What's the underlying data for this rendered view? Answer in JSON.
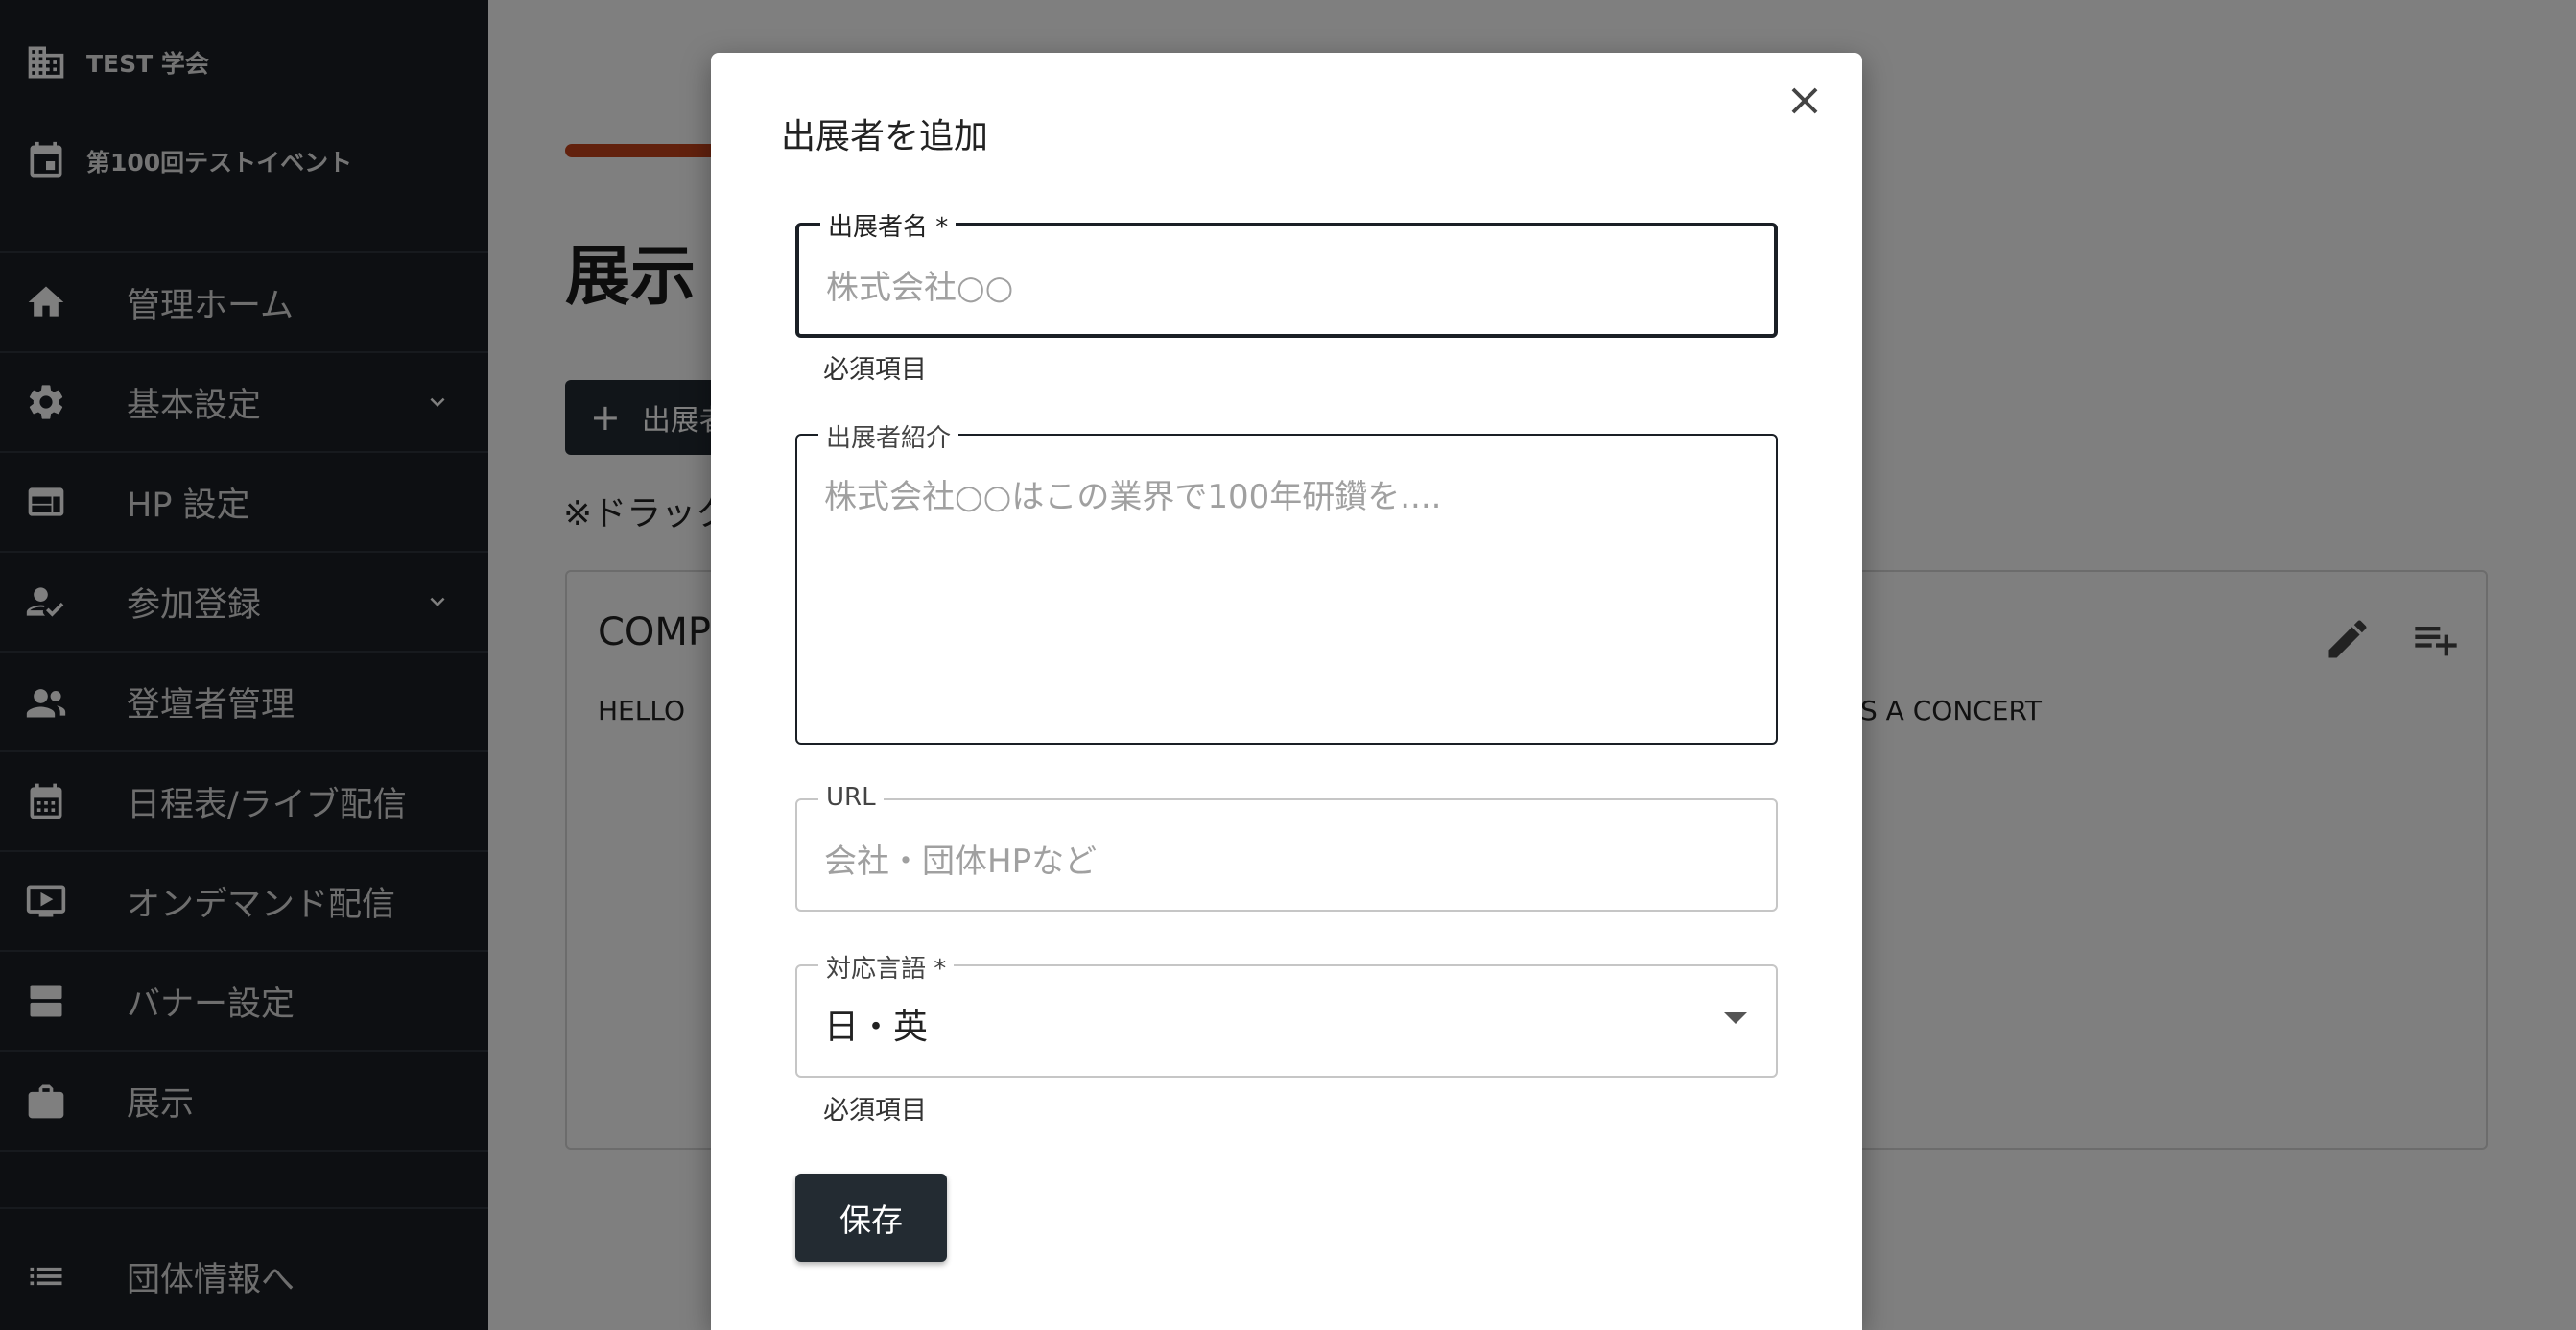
{
  "sidebar": {
    "org": [
      {
        "label": "TEST 学会",
        "icon": "building-icon"
      },
      {
        "label": "第100回テストイベント",
        "icon": "calendar-event-icon"
      }
    ],
    "items": [
      {
        "label": "管理ホーム",
        "icon": "home-icon",
        "expandable": false
      },
      {
        "label": "基本設定",
        "icon": "gear-icon",
        "expandable": true
      },
      {
        "label": "HP 設定",
        "icon": "web-icon",
        "expandable": false
      },
      {
        "label": "参加登録",
        "icon": "person-check-icon",
        "expandable": true
      },
      {
        "label": "登壇者管理",
        "icon": "speaker-group-icon",
        "expandable": false
      },
      {
        "label": "日程表/ライブ配信",
        "icon": "calendar-month-icon",
        "expandable": false
      },
      {
        "label": "オンデマンド配信",
        "icon": "play-video-icon",
        "expandable": false
      },
      {
        "label": "バナー設定",
        "icon": "banner-icon",
        "expandable": false
      },
      {
        "label": "展示",
        "icon": "briefcase-icon",
        "expandable": false
      }
    ],
    "footer": {
      "label": "団体情報へ",
      "icon": "list-icon"
    }
  },
  "main": {
    "page_title": "展示",
    "add_button": "出展者",
    "drag_note": "※ドラック",
    "card": {
      "title": "COMP",
      "text": "HELLO",
      "text_right": "S A CONCERT"
    }
  },
  "modal": {
    "title": "出展者を追加",
    "fields": {
      "name": {
        "label": "出展者名 *",
        "placeholder": "株式会社○○",
        "helper": "必須項目"
      },
      "description": {
        "label": "出展者紹介",
        "placeholder": "株式会社○○はこの業界で100年研鑽を...."
      },
      "url": {
        "label": "URL",
        "placeholder": "会社・団体HPなど"
      },
      "language": {
        "label": "対応言語 *",
        "value": "日・英",
        "helper": "必須項目"
      }
    },
    "save_label": "保存"
  },
  "colors": {
    "sidebar_bg": "#1a1f25",
    "accent": "#c4421a",
    "button_dark": "#232b32"
  }
}
